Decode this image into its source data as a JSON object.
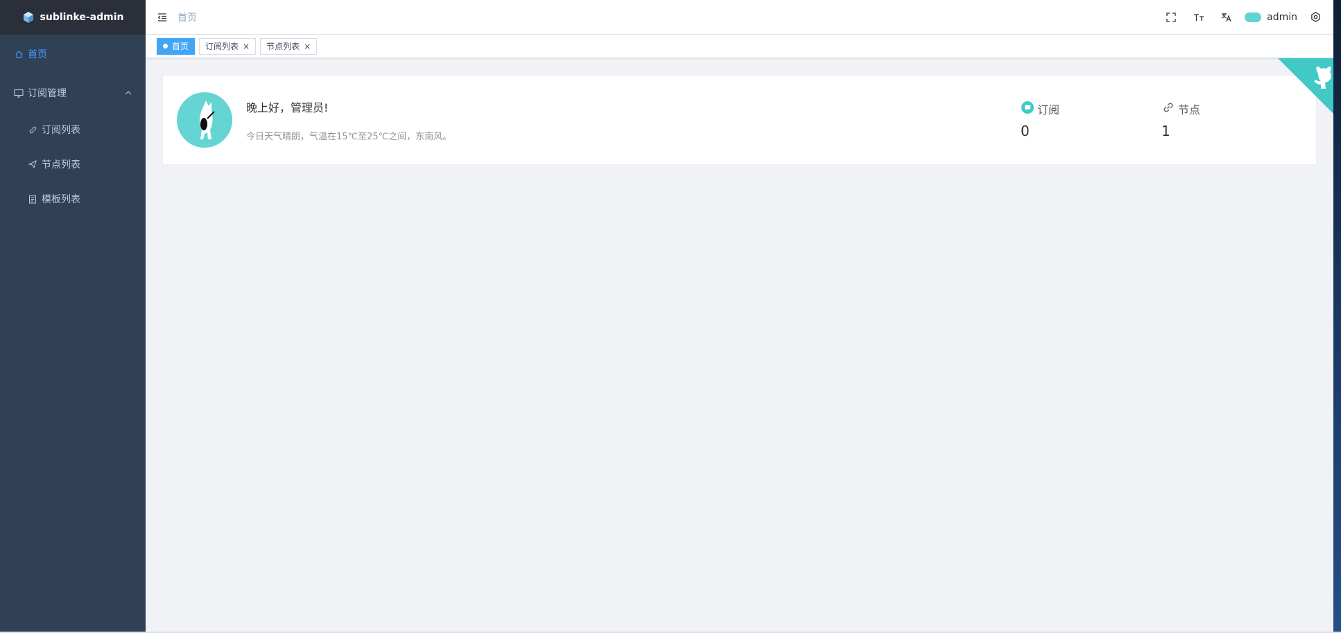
{
  "app": {
    "title": "sublinke-admin"
  },
  "sidebar": {
    "items": [
      {
        "label": "首页",
        "icon": "home-icon",
        "active": true
      },
      {
        "label": "订阅管理",
        "icon": "monitor-icon",
        "expanded": true,
        "children": [
          {
            "label": "订阅列表",
            "icon": "link-icon"
          },
          {
            "label": "节点列表",
            "icon": "send-icon"
          },
          {
            "label": "模板列表",
            "icon": "document-icon"
          }
        ]
      }
    ]
  },
  "navbar": {
    "breadcrumb": "首页",
    "username": "admin"
  },
  "tags": [
    {
      "label": "首页",
      "active": true
    },
    {
      "label": "订阅列表",
      "close": "×"
    },
    {
      "label": "节点列表",
      "close": "×"
    }
  ],
  "dashboard": {
    "greeting": "晚上好，管理员!",
    "weather": "今日天气晴朗，气温在15℃至25℃之间，东南风。",
    "stats": [
      {
        "label": "订阅",
        "value": "0",
        "icon": "message-icon"
      },
      {
        "label": "节点",
        "value": "1",
        "icon": "link-icon"
      }
    ]
  },
  "colors": {
    "sidebar_bg": "#304156",
    "logo_bg": "#2b2f3a",
    "accent": "#409eff",
    "tag_active": "#42a5f5",
    "teal": "#40c9c6"
  }
}
